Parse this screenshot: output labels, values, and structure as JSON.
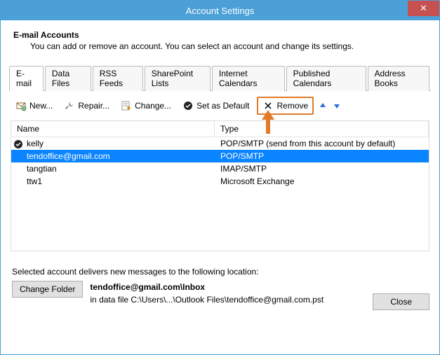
{
  "window": {
    "title": "Account Settings",
    "close_x": "✕"
  },
  "header": {
    "title": "E-mail Accounts",
    "description": "You can add or remove an account. You can select an account and change its settings."
  },
  "tabs": [
    {
      "label": "E-mail",
      "active": true
    },
    {
      "label": "Data Files"
    },
    {
      "label": "RSS Feeds"
    },
    {
      "label": "SharePoint Lists"
    },
    {
      "label": "Internet Calendars"
    },
    {
      "label": "Published Calendars"
    },
    {
      "label": "Address Books"
    }
  ],
  "toolbar": {
    "new": "New...",
    "repair": "Repair...",
    "change": "Change...",
    "set_default": "Set as Default",
    "remove": "Remove"
  },
  "columns": {
    "name": "Name",
    "type": "Type"
  },
  "accounts": [
    {
      "name": "kelly",
      "type": "POP/SMTP (send from this account by default)",
      "default": true
    },
    {
      "name": "tendoffice@gmail.com",
      "type": "POP/SMTP",
      "selected": true
    },
    {
      "name": "tangtian",
      "type": "IMAP/SMTP"
    },
    {
      "name": "ttw1",
      "type": "Microsoft Exchange"
    }
  ],
  "delivery": {
    "intro": "Selected account delivers new messages to the following location:",
    "change_folder": "Change Folder",
    "path_bold": "tendoffice@gmail.com\\Inbox",
    "path_detail": "in data file C:\\Users\\...\\Outlook Files\\tendoffice@gmail.com.pst"
  },
  "footer": {
    "close": "Close"
  }
}
